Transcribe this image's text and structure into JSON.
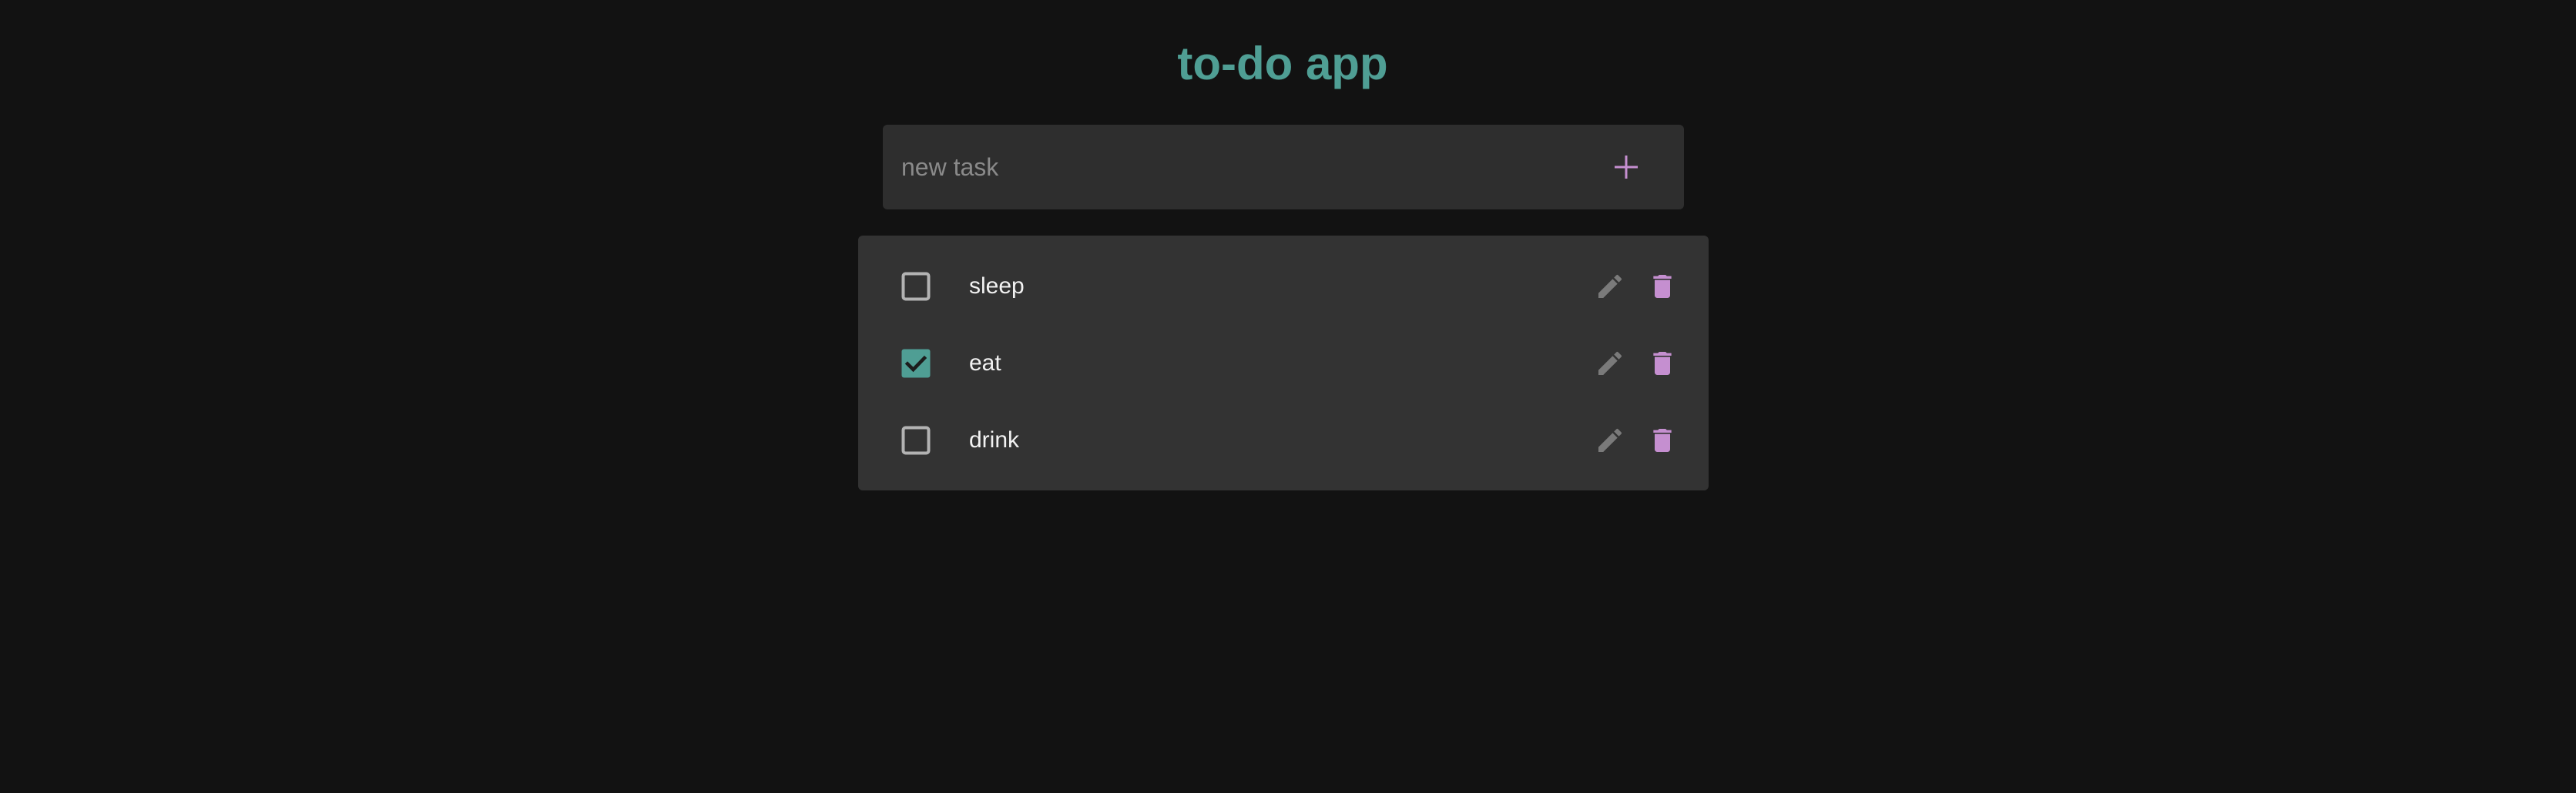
{
  "app": {
    "title": "to-do app"
  },
  "new_task": {
    "placeholder": "new task",
    "value": "",
    "add_icon": "plus-icon"
  },
  "tasks": [
    {
      "label": "sleep",
      "done": false
    },
    {
      "label": "eat",
      "done": true
    },
    {
      "label": "drink",
      "done": false
    }
  ],
  "icons": {
    "edit": "pencil-icon",
    "delete": "trash-icon",
    "checkbox": "checkbox-icon"
  },
  "colors": {
    "background": "#121212",
    "panel": "#333333",
    "input": "#2e2e2e",
    "accent_teal": "#4f9e94",
    "accent_purple": "#c58fd0",
    "muted_icon": "#8a8a8a"
  }
}
